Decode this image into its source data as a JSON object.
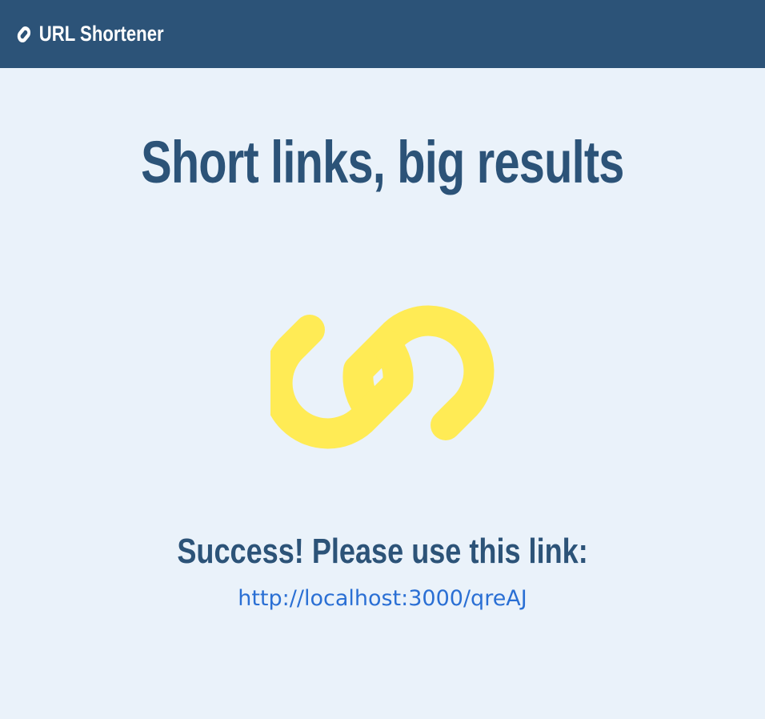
{
  "navbar": {
    "brand_icon": "link-icon",
    "brand_label": "URL Shortener"
  },
  "main": {
    "headline": "Short links, big results",
    "hero_icon": "link-icon",
    "success_message": "Success! Please use this link:",
    "short_url": "http://localhost:3000/qreAJ"
  },
  "colors": {
    "navbar_bg": "#2c5378",
    "page_bg": "#eaf2fa",
    "heading": "#2c5378",
    "icon": "#ffeb55",
    "link": "#2a6fd4"
  }
}
